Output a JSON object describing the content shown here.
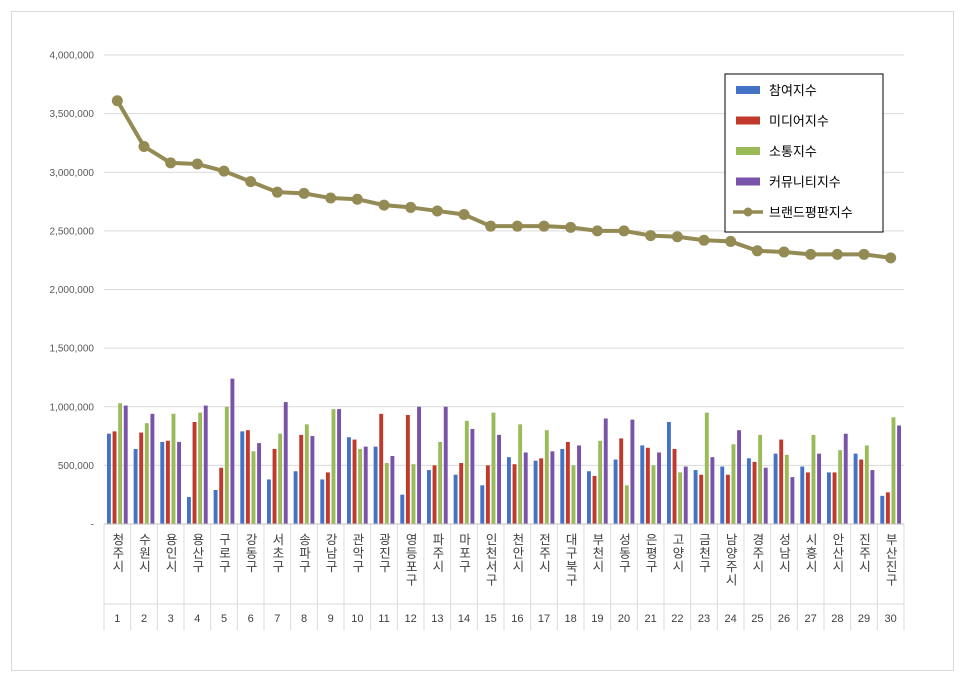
{
  "chart_data": {
    "type": "bar",
    "yticks": [
      "-",
      "500,000",
      "1,000,000",
      "1,500,000",
      "2,000,000",
      "2,500,000",
      "3,000,000",
      "3,500,000",
      "4,000,000"
    ],
    "ylim": [
      0,
      4000000
    ],
    "grid": true,
    "legend_position": "top-right",
    "categories": [
      "청주시",
      "수원시",
      "용인시",
      "용산구",
      "구로구",
      "강동구",
      "서초구",
      "송파구",
      "강남구",
      "관악구",
      "광진구",
      "영등포구",
      "파주시",
      "마포구",
      "인천서구",
      "천안시",
      "전주시",
      "대구북구",
      "부천시",
      "성동구",
      "은평구",
      "고양시",
      "금천구",
      "남양주시",
      "경주시",
      "성남시",
      "시흥시",
      "안산시",
      "진주시",
      "부산진구"
    ],
    "ranks": [
      "1",
      "2",
      "3",
      "4",
      "5",
      "6",
      "7",
      "8",
      "9",
      "10",
      "11",
      "12",
      "13",
      "14",
      "15",
      "16",
      "17",
      "18",
      "19",
      "20",
      "21",
      "22",
      "23",
      "24",
      "25",
      "26",
      "27",
      "28",
      "29",
      "30"
    ],
    "series": [
      {
        "name": "참여지수",
        "color": "#4472C4",
        "kind": "bar",
        "values": [
          770000,
          640000,
          700000,
          230000,
          290000,
          790000,
          380000,
          450000,
          380000,
          740000,
          660000,
          250000,
          460000,
          420000,
          330000,
          570000,
          540000,
          640000,
          450000,
          550000,
          670000,
          870000,
          460000,
          490000,
          560000,
          600000,
          490000,
          440000,
          600000,
          240000
        ]
      },
      {
        "name": "미디어지수",
        "color": "#C0392B",
        "kind": "bar",
        "values": [
          790000,
          780000,
          710000,
          870000,
          480000,
          800000,
          640000,
          760000,
          440000,
          720000,
          940000,
          930000,
          500000,
          520000,
          500000,
          510000,
          560000,
          700000,
          410000,
          730000,
          650000,
          640000,
          420000,
          420000,
          530000,
          720000,
          440000,
          440000,
          550000,
          270000
        ]
      },
      {
        "name": "소통지수",
        "color": "#9BBB59",
        "kind": "bar",
        "values": [
          1030000,
          860000,
          940000,
          950000,
          1000000,
          620000,
          770000,
          850000,
          980000,
          640000,
          520000,
          510000,
          700000,
          880000,
          950000,
          850000,
          800000,
          500000,
          710000,
          330000,
          500000,
          440000,
          950000,
          680000,
          760000,
          590000,
          760000,
          630000,
          670000,
          910000
        ]
      },
      {
        "name": "커뮤니티지수",
        "color": "#7953A9",
        "kind": "bar",
        "values": [
          1010000,
          940000,
          700000,
          1010000,
          1240000,
          690000,
          1040000,
          750000,
          980000,
          660000,
          580000,
          1000000,
          1000000,
          810000,
          760000,
          610000,
          620000,
          670000,
          900000,
          890000,
          610000,
          490000,
          570000,
          800000,
          480000,
          400000,
          600000,
          770000,
          460000,
          840000
        ]
      },
      {
        "name": "브랜드평판지수",
        "color": "#948A54",
        "kind": "line",
        "values": [
          3610000,
          3220000,
          3080000,
          3070000,
          3010000,
          2920000,
          2830000,
          2820000,
          2780000,
          2770000,
          2720000,
          2700000,
          2670000,
          2640000,
          2540000,
          2540000,
          2540000,
          2530000,
          2500000,
          2500000,
          2460000,
          2450000,
          2420000,
          2410000,
          2330000,
          2320000,
          2300000,
          2300000,
          2300000,
          2270000
        ]
      }
    ]
  }
}
